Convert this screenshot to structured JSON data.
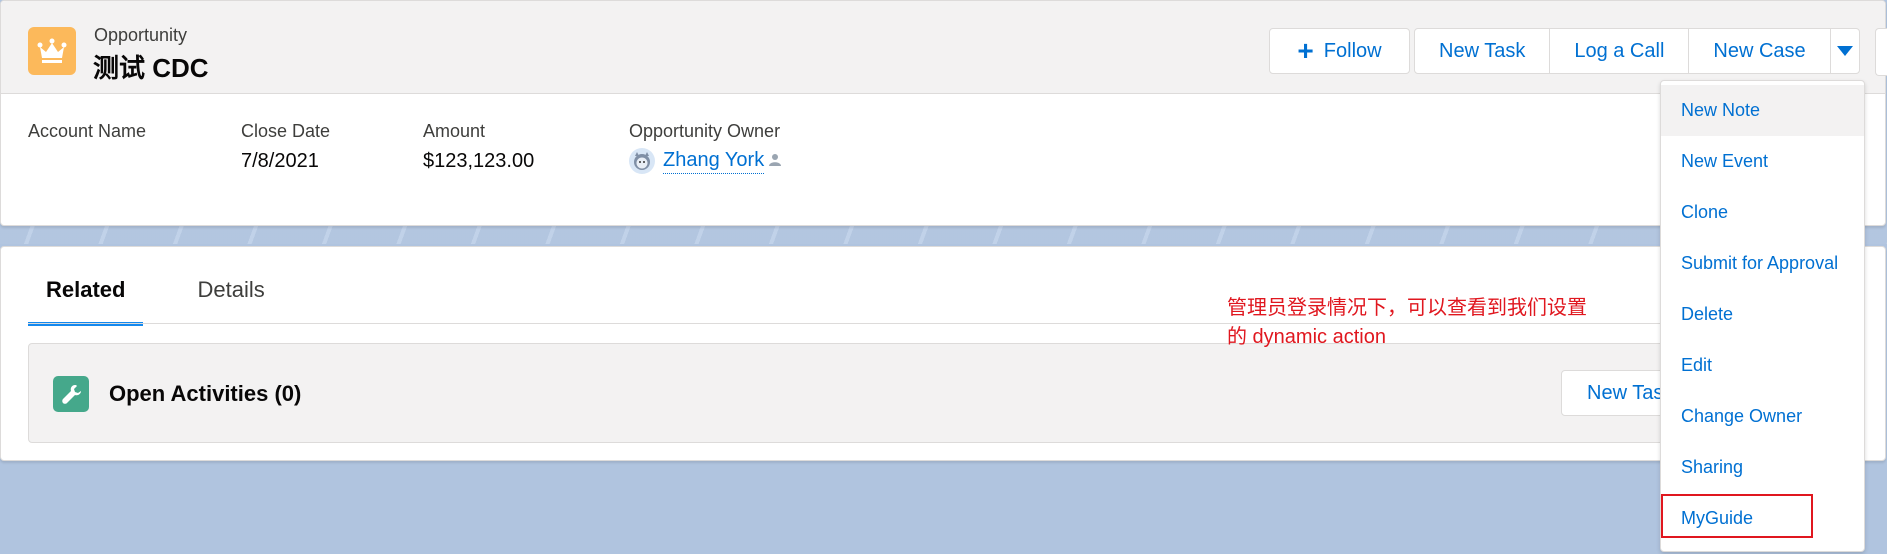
{
  "colors": {
    "accent": "#0070d2",
    "object_icon": "#fcb95b",
    "activity_icon": "#45a88b",
    "annotation": "#e0171f",
    "page_bg": "#b0c4df"
  },
  "header": {
    "object_type": "Opportunity",
    "record_name": "测试 CDC",
    "icon": "crown-icon",
    "follow_label": "Follow",
    "actions": [
      "New Task",
      "Log a Call",
      "New Case"
    ],
    "dropdown_icon": "chevron-down-icon"
  },
  "fields": [
    {
      "label": "Account Name",
      "value": ""
    },
    {
      "label": "Close Date",
      "value": "7/8/2021"
    },
    {
      "label": "Amount",
      "value": "$123,123.00"
    },
    {
      "label": "Opportunity Owner",
      "value": "Zhang York"
    }
  ],
  "tabs": [
    {
      "label": "Related",
      "active": true
    },
    {
      "label": "Details",
      "active": false
    }
  ],
  "related": {
    "title": "Open Activities (0)",
    "icon": "wrench-icon",
    "new_task_label": "New Task"
  },
  "annotation": {
    "line1": "管理员登录情况下，可以查看到我们设置",
    "line2": "的 dynamic action"
  },
  "menu": {
    "items": [
      "New Note",
      "New Event",
      "Clone",
      "Submit for Approval",
      "Delete",
      "Edit",
      "Change Owner",
      "Sharing",
      "MyGuide"
    ],
    "hovered": "New Note",
    "highlighted": "MyGuide"
  }
}
